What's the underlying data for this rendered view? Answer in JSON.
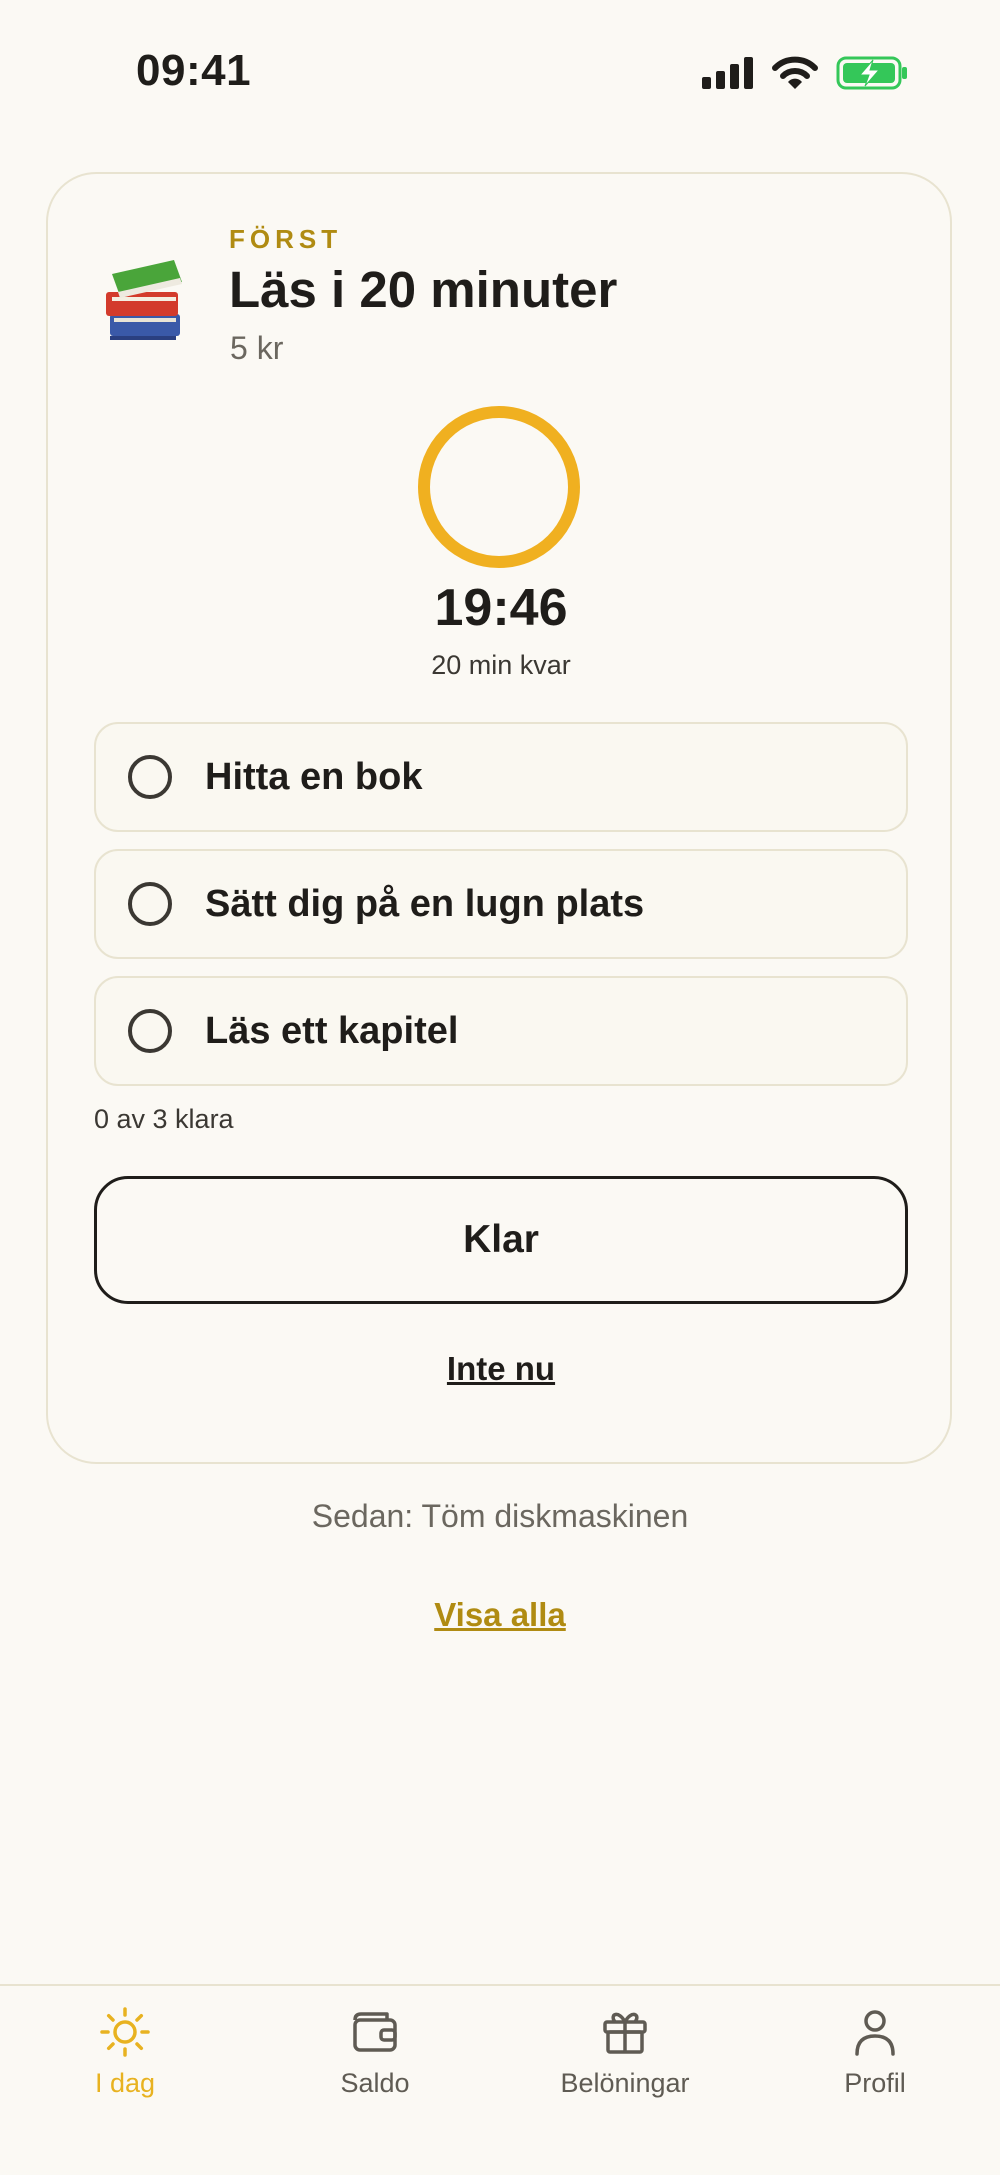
{
  "status_bar": {
    "time": "09:41"
  },
  "task": {
    "eyebrow": "FÖRST",
    "title": "Läs i 20 minuter",
    "reward": "5 kr",
    "emoji": "📚"
  },
  "timer": {
    "value": "19:46",
    "caption": "20 min kvar",
    "ring_color": "#f0b020"
  },
  "checklist": {
    "items": [
      {
        "label": "Hitta en bok",
        "checked": false
      },
      {
        "label": "Sätt dig på en lugn plats",
        "checked": false
      },
      {
        "label": "Läs ett kapitel",
        "checked": false
      }
    ],
    "progress_text": "0 av 3 klara"
  },
  "actions": {
    "done_label": "Klar",
    "not_now_label": "Inte nu"
  },
  "next_task": "Sedan: Töm diskmaskinen",
  "show_all_label": "Visa alla",
  "tabs": [
    {
      "label": "I dag",
      "icon": "sun-icon",
      "active": true
    },
    {
      "label": "Saldo",
      "icon": "wallet-icon",
      "active": false
    },
    {
      "label": "Belöningar",
      "icon": "gift-icon",
      "active": false
    },
    {
      "label": "Profil",
      "icon": "person-icon",
      "active": false
    }
  ],
  "colors": {
    "accent": "#e8b220",
    "eyebrow": "#b08b12",
    "battery": "#34c759",
    "background": "#fbf9f4"
  }
}
